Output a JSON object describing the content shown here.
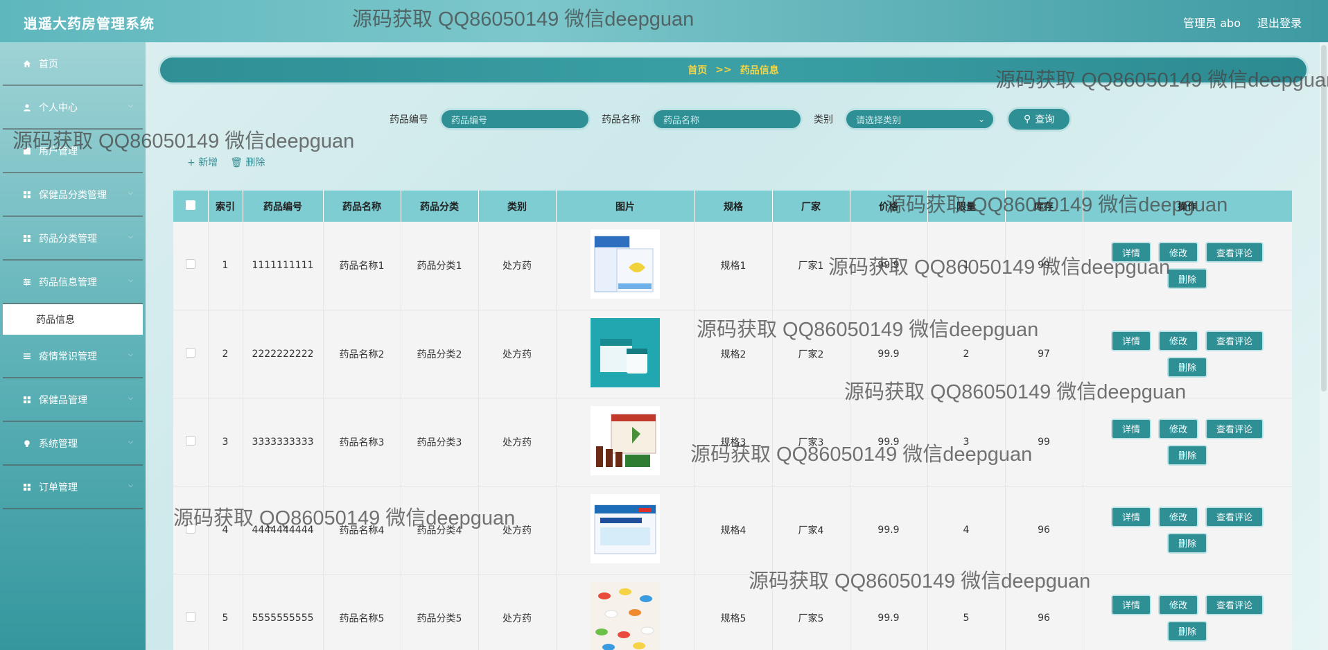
{
  "header": {
    "app_title": "逍遥大药房管理系统",
    "user_label": "管理员 abo",
    "logout_label": "退出登录"
  },
  "sidebar": {
    "items": [
      {
        "label": "首页",
        "icon": "home-icon",
        "has_chevron": false
      },
      {
        "label": "个人中心",
        "icon": "user-icon",
        "has_chevron": true
      },
      {
        "label": "用户管理",
        "icon": "users-icon",
        "has_chevron": false
      },
      {
        "label": "保健品分类管理",
        "icon": "grid-icon",
        "has_chevron": true
      },
      {
        "label": "药品分类管理",
        "icon": "grid-icon",
        "has_chevron": true
      },
      {
        "label": "药品信息管理",
        "icon": "sliders-icon",
        "has_chevron": true
      },
      {
        "label": "疫情常识管理",
        "icon": "list-icon",
        "has_chevron": true
      },
      {
        "label": "保健品管理",
        "icon": "grid-icon",
        "has_chevron": true
      },
      {
        "label": "系统管理",
        "icon": "bulb-icon",
        "has_chevron": true
      },
      {
        "label": "订单管理",
        "icon": "grid-icon",
        "has_chevron": true
      }
    ],
    "active_sub": "药品信息"
  },
  "breadcrumb": {
    "home": "首页",
    "sep": ">>",
    "current": "药品信息"
  },
  "search": {
    "code_label": "药品编号",
    "code_placeholder": "药品编号",
    "name_label": "药品名称",
    "name_placeholder": "药品名称",
    "type_label": "类别",
    "type_placeholder": "请选择类别",
    "button": "查询"
  },
  "actions": {
    "add": "新增",
    "delete": "删除"
  },
  "table": {
    "columns": [
      "索引",
      "药品编号",
      "药品名称",
      "药品分类",
      "类别",
      "图片",
      "规格",
      "厂家",
      "价格",
      "限量",
      "库存",
      "操作"
    ],
    "rows": [
      {
        "index": "1",
        "code": "1111111111",
        "name": "药品名称1",
        "category": "药品分类1",
        "type": "处方药",
        "spec": "规格1",
        "maker": "厂家1",
        "price": "99.9",
        "limit": "1",
        "stock": "99"
      },
      {
        "index": "2",
        "code": "2222222222",
        "name": "药品名称2",
        "category": "药品分类2",
        "type": "处方药",
        "spec": "规格2",
        "maker": "厂家2",
        "price": "99.9",
        "limit": "2",
        "stock": "97"
      },
      {
        "index": "3",
        "code": "3333333333",
        "name": "药品名称3",
        "category": "药品分类3",
        "type": "处方药",
        "spec": "规格3",
        "maker": "厂家3",
        "price": "99.9",
        "limit": "3",
        "stock": "99"
      },
      {
        "index": "4",
        "code": "4444444444",
        "name": "药品名称4",
        "category": "药品分类4",
        "type": "处方药",
        "spec": "规格4",
        "maker": "厂家4",
        "price": "99.9",
        "limit": "4",
        "stock": "96"
      },
      {
        "index": "5",
        "code": "5555555555",
        "name": "药品名称5",
        "category": "药品分类5",
        "type": "处方药",
        "spec": "规格5",
        "maker": "厂家5",
        "price": "99.9",
        "limit": "5",
        "stock": "96"
      }
    ],
    "op_labels": {
      "detail": "详情",
      "edit": "修改",
      "comments": "查看评论",
      "delete": "删除"
    }
  },
  "watermark": "源码获取 QQ86050149 微信deepguan",
  "colors": {
    "accent": "#2e8f95",
    "breadcrumb_text": "#f5d442",
    "header_cell": "#7ecdd2"
  }
}
